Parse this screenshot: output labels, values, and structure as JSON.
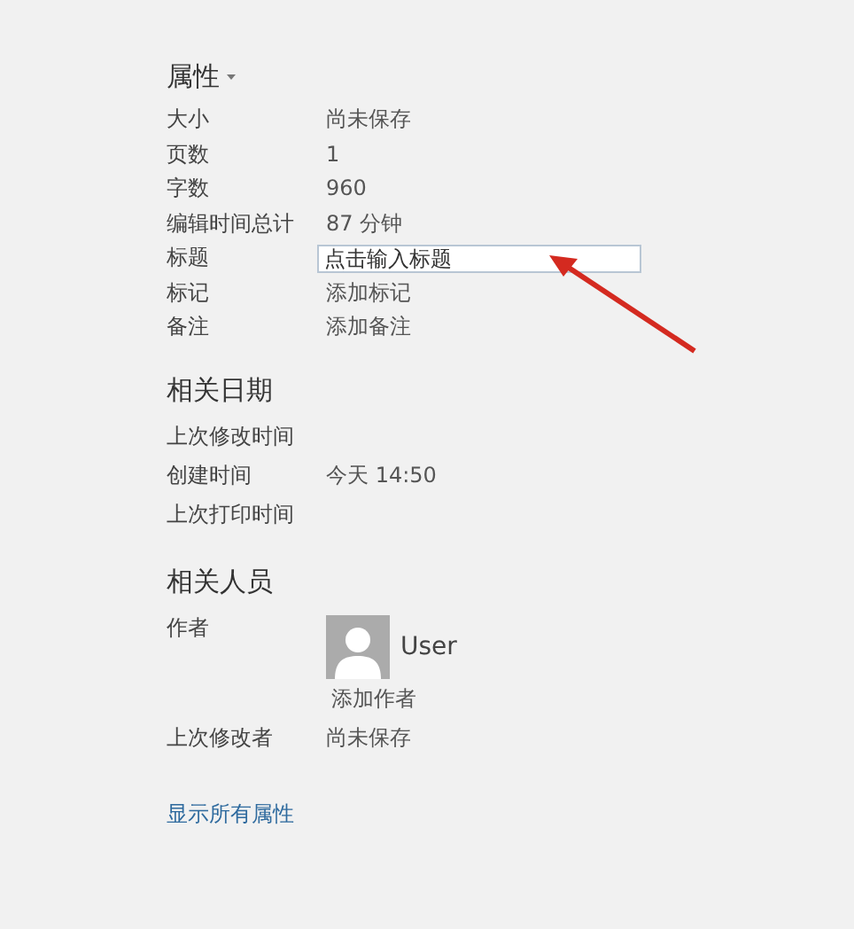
{
  "sections": [
    {
      "title": "属性",
      "dropdown": true,
      "rows": [
        {
          "kind": "text",
          "label": "大小",
          "value": "尚未保存"
        },
        {
          "kind": "text",
          "label": "页数",
          "value": "1"
        },
        {
          "kind": "text",
          "label": "字数",
          "value": "960"
        },
        {
          "kind": "text",
          "label": "编辑时间总计",
          "value": "87  分钟"
        },
        {
          "kind": "field",
          "label": "标题",
          "placeholder": "点击输入标题"
        },
        {
          "kind": "text",
          "label": "标记",
          "value": "添加标记"
        },
        {
          "kind": "text",
          "label": "备注",
          "value": "添加备注"
        }
      ]
    },
    {
      "title": "相关日期",
      "dropdown": false,
      "rows": [
        {
          "kind": "text",
          "label": "上次修改时间"
        },
        {
          "kind": "text",
          "label": "创建时间",
          "value": "今天 14:50"
        },
        {
          "kind": "text",
          "label": "上次打印时间"
        }
      ]
    },
    {
      "title": "相关人员",
      "dropdown": false,
      "rows": [
        {
          "kind": "person",
          "label": "作者",
          "name": "User",
          "action": "添加作者"
        },
        {
          "kind": "text",
          "label": "上次修改者",
          "value": "尚未保存"
        }
      ]
    }
  ],
  "link": "显示所有属性"
}
